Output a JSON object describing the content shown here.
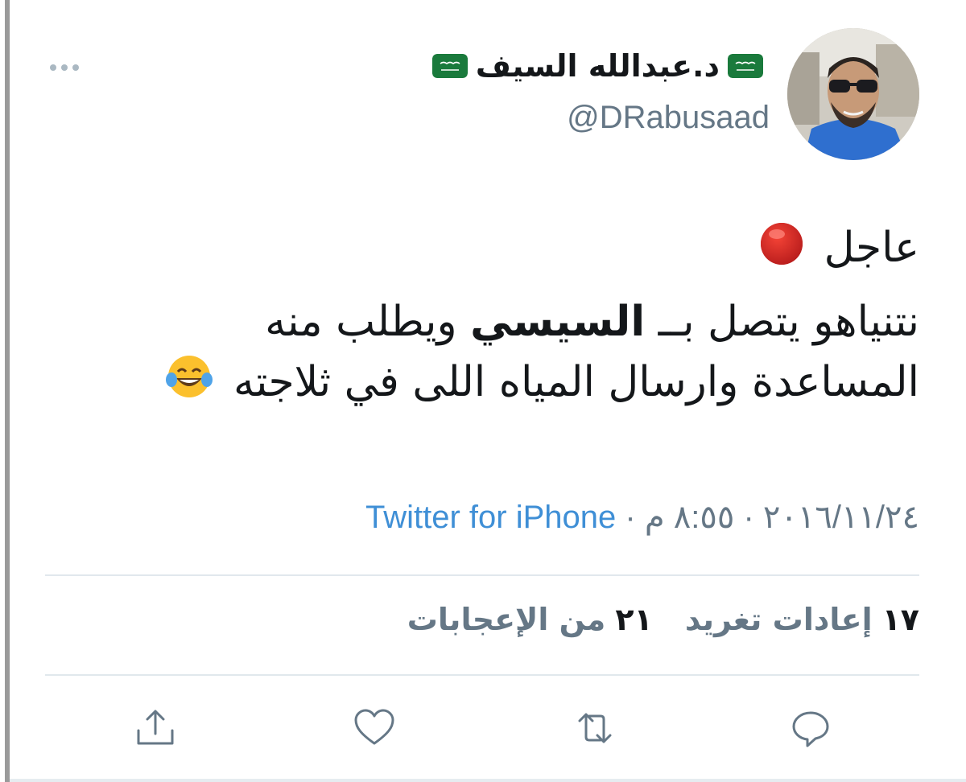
{
  "author": {
    "display_name": "د.عبدالله السيف",
    "handle": "@DRabusaad",
    "flag_icon": "saudi-flag-icon"
  },
  "tweet": {
    "line1_text": "عاجل",
    "line1_emoji": "red-circle-emoji",
    "line2_part1": "نتنياهو يتصل بــ",
    "line2_bold": "السيسي",
    "line2_part2": "ويطلب منه",
    "line3_text": "المساعدة وارسال المياه اللى في ثلاجته",
    "line3_emoji": "face-with-tears-of-joy-emoji"
  },
  "meta": {
    "date": "٢٠١٦/١١/٢٤",
    "separator": "·",
    "time": "٨:٥٥ م",
    "source": "Twitter for iPhone"
  },
  "stats": {
    "retweets_count": "١٧",
    "retweets_label": "إعادات تغريد",
    "likes_count": "٢١",
    "likes_label": "من الإعجابات"
  },
  "actions": {
    "reply_icon": "reply-icon",
    "retweet_icon": "retweet-icon",
    "like_icon": "heart-icon",
    "share_icon": "share-icon"
  },
  "colors": {
    "text": "#14171a",
    "muted": "#657786",
    "link": "#3f8fd6",
    "icon": "#657786",
    "flag_green": "#1a7a3c"
  }
}
